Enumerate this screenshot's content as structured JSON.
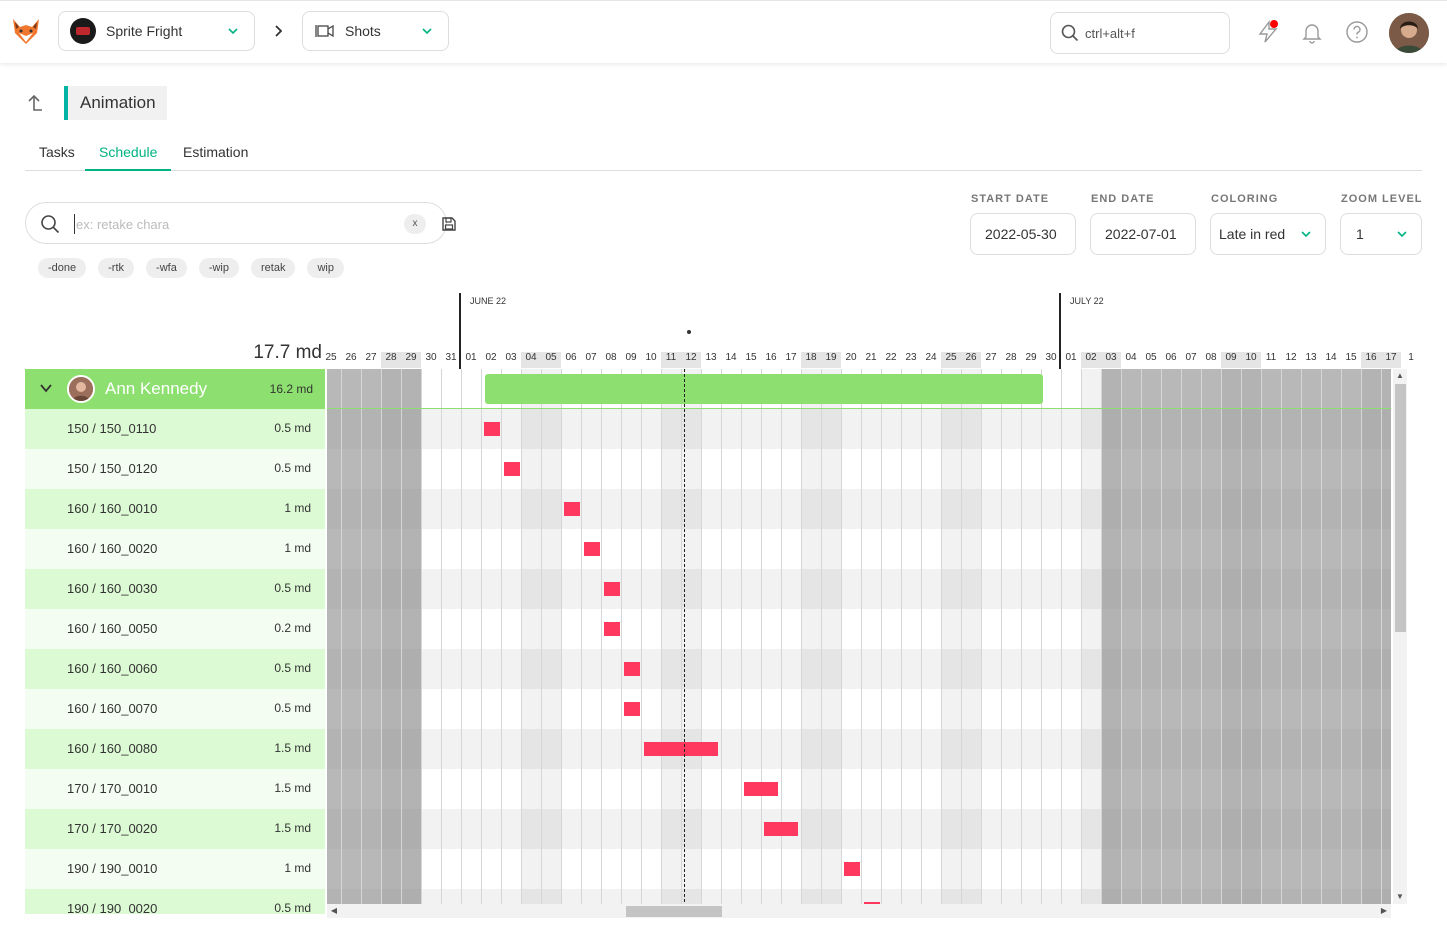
{
  "topbar": {
    "production": "Sprite Fright",
    "section": "Shots",
    "search_placeholder": "ctrl+alt+f"
  },
  "page": {
    "title": "Animation",
    "tabs": [
      {
        "label": "Tasks",
        "active": false
      },
      {
        "label": "Schedule",
        "active": true
      },
      {
        "label": "Estimation",
        "active": false
      }
    ]
  },
  "filters": {
    "search_placeholder": "ex: retake chara",
    "clear_label": "x",
    "chips": [
      "-done",
      "-rtk",
      "-wfa",
      "-wip",
      "retak",
      "wip"
    ]
  },
  "settings": {
    "start_date_label": "START DATE",
    "start_date": "2022-05-30",
    "end_date_label": "END DATE",
    "end_date": "2022-07-01",
    "coloring_label": "COLORING",
    "coloring": "Late in red",
    "zoom_label": "ZOOM LEVEL",
    "zoom": "1"
  },
  "timeline": {
    "total": "17.7 md",
    "months": [
      "JUNE 22",
      "JULY 22"
    ],
    "days": [
      "25",
      "26",
      "27",
      "28",
      "29",
      "30",
      "31",
      "01",
      "02",
      "03",
      "04",
      "05",
      "06",
      "07",
      "08",
      "09",
      "10",
      "11",
      "12",
      "13",
      "14",
      "15",
      "16",
      "17",
      "18",
      "19",
      "20",
      "21",
      "22",
      "23",
      "24",
      "25",
      "26",
      "27",
      "28",
      "29",
      "30",
      "01",
      "02",
      "03",
      "04",
      "05",
      "06",
      "07",
      "08",
      "09",
      "10",
      "11",
      "12",
      "13",
      "14",
      "15",
      "16",
      "17",
      "1"
    ],
    "weekend_days": [
      3,
      4,
      10,
      11,
      17,
      18,
      24,
      25,
      31,
      32,
      38,
      39,
      45,
      46,
      52,
      53
    ],
    "today_index": 18,
    "out_of_range_before": 5,
    "out_of_range_after_start": 39
  },
  "person": {
    "name": "Ann Kennedy",
    "total": "16.2 md",
    "bar_start_index": 8,
    "bar_end_index": 36
  },
  "tasks": [
    {
      "name": "150 / 150_0110",
      "md": "0.5 md",
      "start": 8,
      "len": 0.8
    },
    {
      "name": "150 / 150_0120",
      "md": "0.5 md",
      "start": 9,
      "len": 0.8
    },
    {
      "name": "160 / 160_0010",
      "md": "1 md",
      "start": 12,
      "len": 0.8
    },
    {
      "name": "160 / 160_0020",
      "md": "1 md",
      "start": 13,
      "len": 0.8
    },
    {
      "name": "160 / 160_0030",
      "md": "0.5 md",
      "start": 14,
      "len": 0.8
    },
    {
      "name": "160 / 160_0050",
      "md": "0.2 md",
      "start": 14,
      "len": 0.8
    },
    {
      "name": "160 / 160_0060",
      "md": "0.5 md",
      "start": 15,
      "len": 0.8
    },
    {
      "name": "160 / 160_0070",
      "md": "0.5 md",
      "start": 15,
      "len": 0.8
    },
    {
      "name": "160 / 160_0080",
      "md": "1.5 md",
      "start": 16,
      "len": 3.7
    },
    {
      "name": "170 / 170_0010",
      "md": "1.5 md",
      "start": 21,
      "len": 1.7
    },
    {
      "name": "170 / 170_0020",
      "md": "1.5 md",
      "start": 22,
      "len": 1.7
    },
    {
      "name": "190 / 190_0010",
      "md": "1 md",
      "start": 26,
      "len": 0.8
    },
    {
      "name": "190 / 190_0020",
      "md": "0.5 md",
      "start": 27,
      "len": 0.8
    }
  ],
  "colors": {
    "accent": "#00b382",
    "person_row": "#8de06f",
    "late_task": "#ff3860",
    "person_bar": "#8de06f"
  }
}
